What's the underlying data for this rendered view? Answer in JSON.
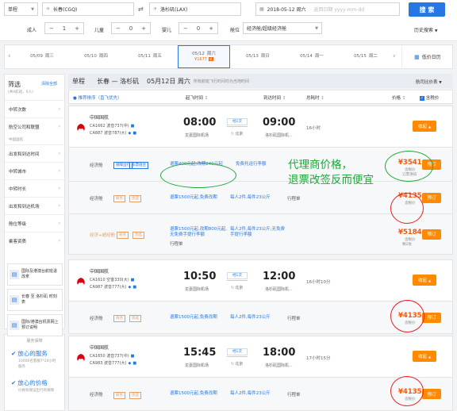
{
  "search": {
    "trip_type": "单程",
    "from": "长春(CGQ)",
    "to": "洛杉矶(LAX)",
    "date": "2018-05-12 周六",
    "return_placeholder": "返回日期 yyyy-mm-dd",
    "search_label": "搜 索",
    "adult_label": "成人",
    "adult_count": "1",
    "child_label": "儿童",
    "child_count": "0",
    "infant_label": "婴儿",
    "infant_count": "0",
    "cabin_label": "舱位",
    "cabin_value": "经济舱/超级经济舱",
    "history_label": "历史搜索"
  },
  "dates": [
    {
      "date": "05/09",
      "week": "周三",
      "price": ""
    },
    {
      "date": "05/10",
      "week": "周四",
      "price": ""
    },
    {
      "date": "05/11",
      "week": "周五",
      "price": ""
    },
    {
      "date": "05/12",
      "week": "周六",
      "price": "¥1677"
    },
    {
      "date": "05/13",
      "week": "周日",
      "price": ""
    },
    {
      "date": "05/14",
      "week": "周一",
      "price": ""
    },
    {
      "date": "05/15",
      "week": "周二",
      "price": ""
    }
  ],
  "low_price_label": "低价日历",
  "sidebar": {
    "title": "筛选",
    "subtitle": "(共0航班，0人)",
    "clear": "清除全部",
    "items": [
      "中转次数",
      "航空公司和联盟",
      "中国国航",
      "出发和到达时间",
      "中转城市",
      "中转时长",
      "出发和到达机场",
      "舱位等级",
      "乘客资质"
    ],
    "promos": [
      "国际及港澳台航班退改拿",
      "长春 至 洛杉矶 时刻表",
      "国际/港澳台机票网上预订说明"
    ],
    "service_title": "服务保障",
    "service1": "放心的服务",
    "service1_sub": "10000名客服7*24小时服务",
    "service2": "放心的价格",
    "service2_sub": "价格有保证出行有保障"
  },
  "header": {
    "trip": "单程",
    "route": "长春 — 洛杉矶",
    "date": "05月12日 周六",
    "note": "所有航班飞行时间均为当地时间",
    "price_list": "航司比价表"
  },
  "columns": {
    "sort": "推荐排序（直飞优先）",
    "dep": "起飞时间",
    "arr": "到达时间",
    "dur": "总耗时",
    "price": "价格",
    "tax": "含税价"
  },
  "flights": [
    {
      "airline": "中国国航",
      "flight1": "CA1662 波音737(中)",
      "flight2": "CA887 波音787(大)",
      "dep_time": "08:00",
      "dep_apt": "龙嘉国际机场",
      "stop": "经1次",
      "stop_city": "北京",
      "arr_time": "09:00",
      "arr_apt": "洛杉矶国际机...",
      "duration": "16小时",
      "fold": "收起"
    },
    {
      "airline": "中国国航",
      "flight1": "CA1610 空客330(大)",
      "flight2": "CA987 波音777(大)",
      "dep_time": "10:50",
      "dep_apt": "龙嘉国际机场",
      "stop": "经1次",
      "stop_city": "北京",
      "arr_time": "12:00",
      "arr_apt": "洛杉矶国际机...",
      "duration": "16小时10分",
      "fold": "收起"
    },
    {
      "airline": "中国国航",
      "flight1": "CA1650 波音737(中)",
      "flight2": "CA983 波音777(大)",
      "dep_time": "15:45",
      "dep_apt": "龙嘉国际机场",
      "stop": "经1次",
      "stop_city": "北京",
      "arr_time": "18:00",
      "arr_apt": "洛杉矶国际机...",
      "duration": "17小时15分",
      "fold": "收起"
    }
  ],
  "fares": {
    "f1a": {
      "cabin": "经济舱",
      "tag1": "保障出行",
      "tag2": "多票组合",
      "rule": "退票400元起,改期240元起",
      "bag": "免费托运行李额",
      "price": "¥3541",
      "tax": "含税价",
      "note": "订票须知",
      "book": "预订"
    },
    "f1b": {
      "cabin": "经济舱",
      "tag1": "商务",
      "tag2": "优选",
      "rule": "退票1500元起,免费改期",
      "bag": "每人2件,每件23公斤",
      "extra": "行程单",
      "price": "¥4135",
      "tax": "含税价",
      "book": "预订"
    },
    "f1c": {
      "cabin": "经济+超经舱",
      "tag1": "商务",
      "tag2": "优选",
      "rule": "退票1500元起,改期800元起,无免费手提行李额",
      "bag": "每人2件,每件23公斤,无免费手提行李额",
      "extra": "行程单",
      "price": "¥5184",
      "tax": "含税价",
      "note": "剩2张",
      "book": "预订"
    },
    "f2a": {
      "cabin": "经济舱",
      "tag1": "商务",
      "tag2": "优选",
      "rule": "退票1500元起,免费改期",
      "bag": "每人2件,每件23公斤",
      "extra": "行程单",
      "price": "¥4135",
      "tax": "含税价",
      "book": "预订"
    },
    "f3a": {
      "cabin": "经济舱",
      "tag1": "商务",
      "tag2": "优选",
      "rule": "退票1500元起,免费改期",
      "bag": "每人2件,每件23公斤",
      "extra": "行程单",
      "price": "¥4135",
      "tax": "含税价",
      "book": "预订"
    }
  },
  "annotation": {
    "line1": "代理商价格，",
    "line2": "退票改签反而便宜"
  },
  "colors": {
    "accent": "#2577e3",
    "orange": "#ff8a00",
    "price": "#ff5500",
    "green_note": "#1fa63a",
    "red_circle": "#e62020",
    "airline_red": "#d7000f"
  }
}
